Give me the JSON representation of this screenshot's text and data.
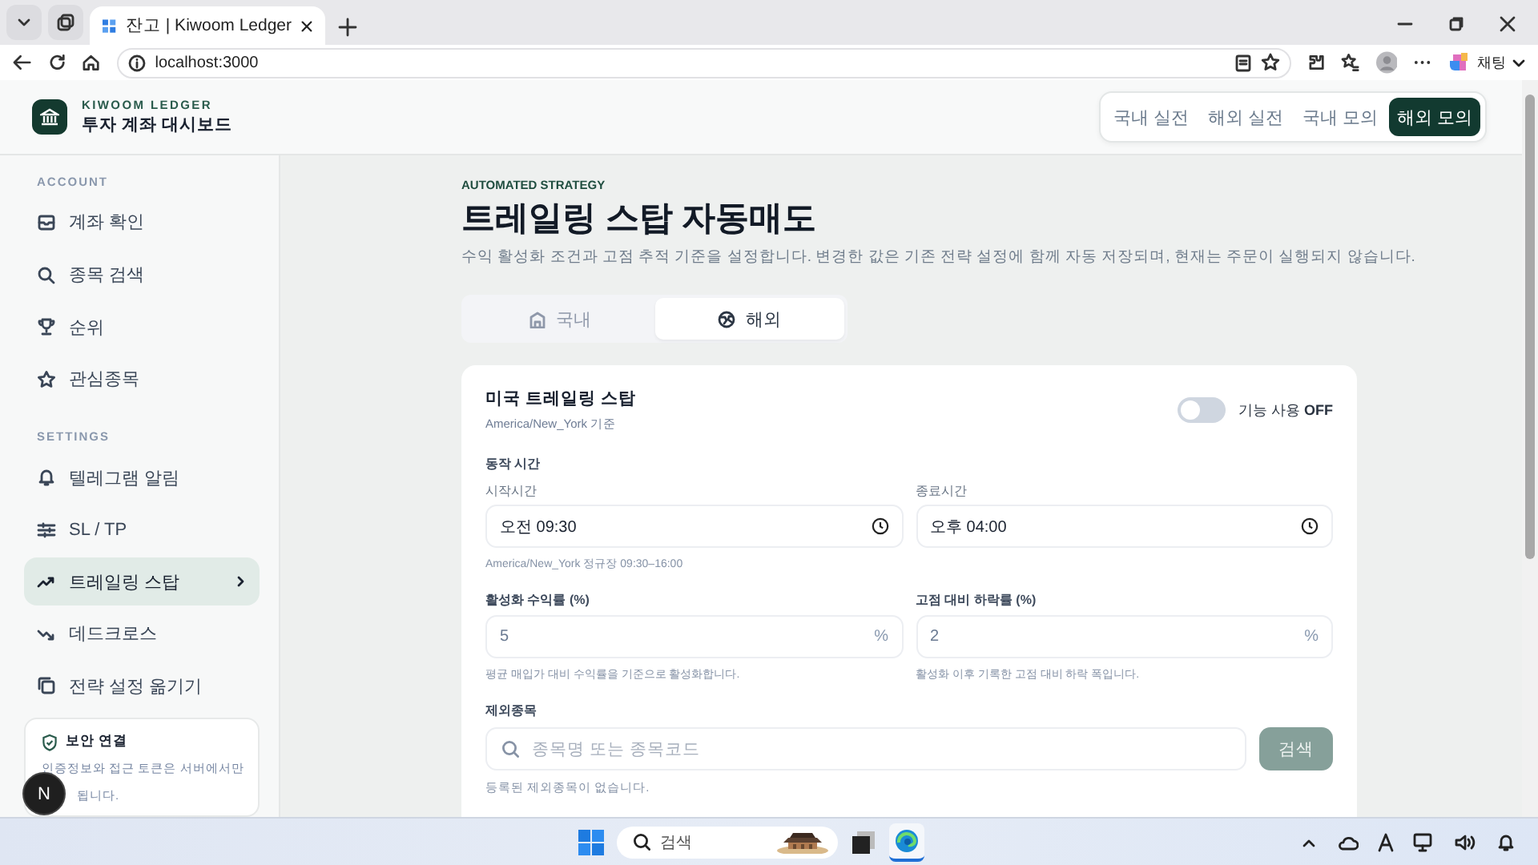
{
  "browser": {
    "tab_title": "잔고 | Kiwoom Ledger",
    "address": "localhost:3000",
    "copilot_label": "채팅"
  },
  "brand": {
    "eyebrow": "KIWOOM LEDGER",
    "title": "투자 계좌 대시보드"
  },
  "account_tabs": [
    {
      "label": "국내 실전",
      "selected": false
    },
    {
      "label": "해외 실전",
      "selected": false
    },
    {
      "label": "국내 모의",
      "selected": false
    },
    {
      "label": "해외 모의",
      "selected": true
    }
  ],
  "sidebar": {
    "sections": [
      {
        "heading": "ACCOUNT",
        "items": [
          {
            "label": "계좌 확인",
            "selected": false
          },
          {
            "label": "종목 검색",
            "selected": false
          },
          {
            "label": "순위",
            "selected": false
          },
          {
            "label": "관심종목",
            "selected": false
          }
        ]
      },
      {
        "heading": "SETTINGS",
        "items": [
          {
            "label": "텔레그램 알림",
            "selected": false
          },
          {
            "label": "SL / TP",
            "selected": false
          },
          {
            "label": "트레일링 스탑",
            "selected": true
          },
          {
            "label": "데드크로스",
            "selected": false
          },
          {
            "label": "전략 설정 옮기기",
            "selected": false
          }
        ]
      }
    ],
    "security": {
      "title": "보안 연결",
      "lines": [
        "인증정보와 접근 토큰은 서버에서만",
        "됩니다."
      ],
      "badge": "N"
    }
  },
  "main": {
    "eyebrow": "AUTOMATED STRATEGY",
    "title": "트레일링 스탑 자동매도",
    "description": "수익 활성화 조건과 고점 추적 기준을 설정합니다. 변경한 값은 기존 전략 설정에 함께 자동 저장되며, 현재는 주문이 실행되지 않습니다.",
    "market_tabs": [
      {
        "label": "국내",
        "selected": false
      },
      {
        "label": "해외",
        "selected": true
      }
    ],
    "card": {
      "title": "미국 트레일링 스탑",
      "subtitle": "America/New_York 기준",
      "toggle": {
        "on": false,
        "label": "기능 사용 **OFF**"
      },
      "schedule": {
        "heading": "동작 시간",
        "start": {
          "label": "시작시간",
          "value": "오전 09:30"
        },
        "end": {
          "label": "종료시간",
          "value": "오후 04:00"
        },
        "hint": "America/New_York 정규장 09:30–16:00"
      },
      "fields": [
        {
          "label": "활성화 수익률 (%)",
          "value": "5",
          "unit": "%",
          "hint": "평균 매입가 대비 수익률을 기준으로 활성화합니다."
        },
        {
          "label": "고점 대비 하락률 (%)",
          "value": "2",
          "unit": "%",
          "hint": "활성화 이후 기록한 고점 대비 하락 폭입니다."
        }
      ],
      "exclude": {
        "heading": "제외종목",
        "placeholder": "종목명 또는 종목코드",
        "button": "검색",
        "disabled": true,
        "empty": "등록된 제외종목이 없습니다."
      }
    }
  },
  "taskbar": {
    "search_placeholder": "검색"
  }
}
